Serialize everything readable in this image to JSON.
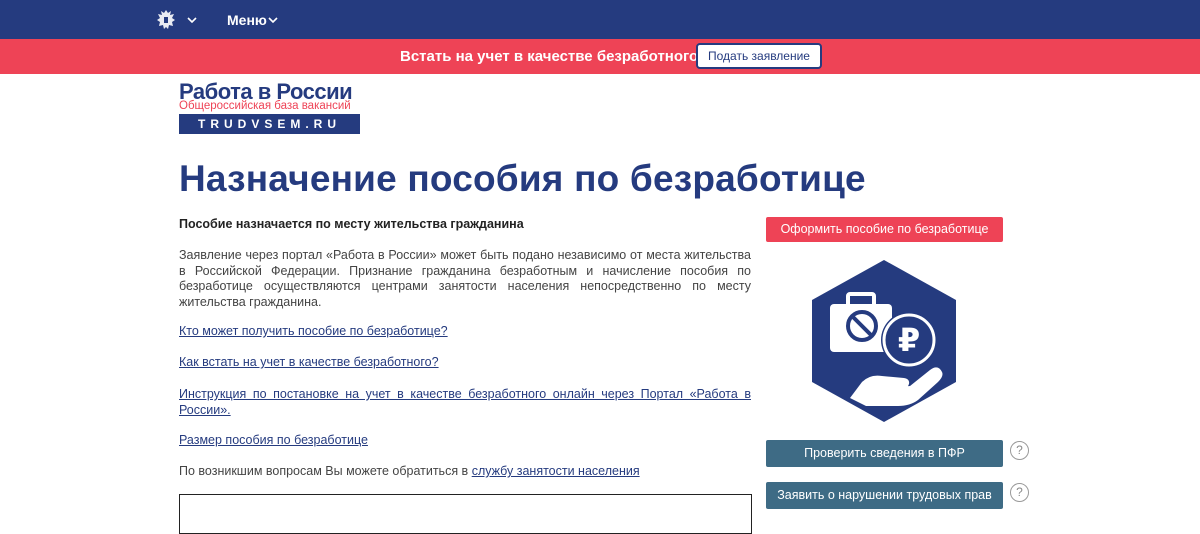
{
  "topbar": {
    "menu_label": "Меню",
    "emblem_icon": "coat-of-arms-icon",
    "bg_color": "#253b7f"
  },
  "banner": {
    "text": "Встать на учет в качестве безработного",
    "button_label": "Подать заявление",
    "bg_color": "#ee4356"
  },
  "logo": {
    "title": "Работа в России",
    "subtitle": "Общероссийская база вакансий",
    "domain": "TRUDVSEM.RU"
  },
  "main": {
    "title": "Назначение пособия по безработице",
    "lead": "Пособие назначается по месту жительства гражданина",
    "paragraph": "Заявление через портал «Работа в России» может быть подано независимо от места жительства в Российской Федерации. Признание гражданина безработным и начисление пособия по безработице осуществляются центрами занятости населения непосредственно по месту жительства гражданина.",
    "links": [
      "Кто может получить пособие по безработице?",
      "Как встать на учет в качестве безработного?",
      "Инструкция по постановке на учет в качестве безработного онлайн через Портал «Работа в России».",
      "Размер пособия по безработице"
    ],
    "contact_text": "По возникшим вопросам Вы можете обратиться в ",
    "contact_link": "службу занятости населения"
  },
  "sidebar": {
    "benefit_button": "Оформить пособие по безработице",
    "illustration_icon": "briefcase-ruble-hand-icon",
    "check_pfr_button": "Проверить сведения в ПФР",
    "report_button": "Заявить о нарушении трудовых прав",
    "help_mark": "?"
  },
  "colors": {
    "brand_blue": "#253b7f",
    "accent_red": "#ee4356",
    "button_grey": "#3e6b85"
  }
}
